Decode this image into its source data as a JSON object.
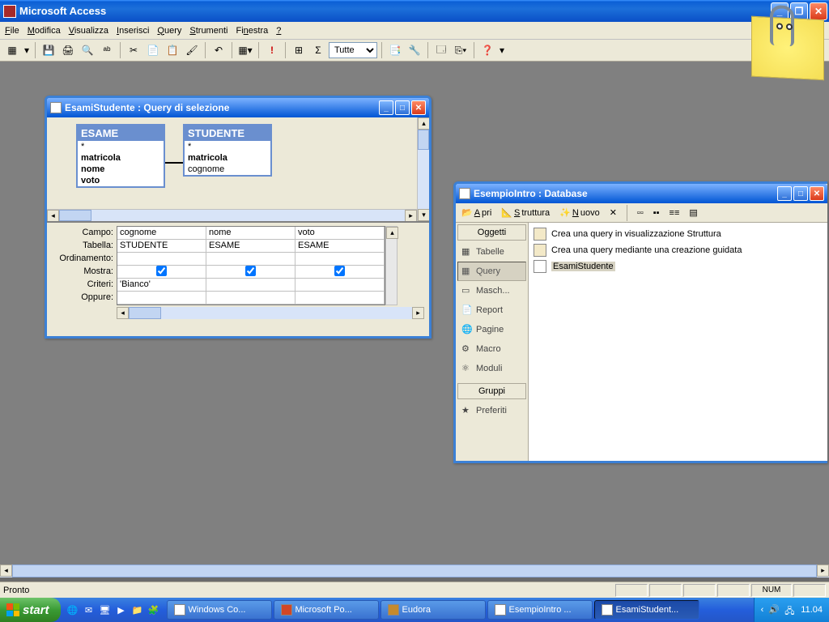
{
  "app": {
    "title": "Microsoft Access"
  },
  "menu": {
    "file": "File",
    "edit": "Modifica",
    "view": "Visualizza",
    "insert": "Inserisci",
    "query": "Query",
    "tools": "Strumenti",
    "window": "Finestra",
    "help": "?"
  },
  "toolbar": {
    "combo_value": "Tutte"
  },
  "queryWin": {
    "title": "EsamiStudente : Query di selezione",
    "tables": {
      "esame": {
        "name": "ESAME",
        "fields": [
          "*",
          "matricola",
          "nome",
          "voto"
        ],
        "bold": [
          1,
          2,
          3
        ]
      },
      "studente": {
        "name": "STUDENTE",
        "fields": [
          "*",
          "matricola",
          "cognome"
        ],
        "bold": [
          1
        ]
      }
    },
    "gridLabels": {
      "campo": "Campo:",
      "tabella": "Tabella:",
      "ordinamento": "Ordinamento:",
      "mostra": "Mostra:",
      "criteri": "Criteri:",
      "oppure": "Oppure:"
    },
    "columns": [
      {
        "campo": "cognome",
        "tabella": "STUDENTE",
        "mostra": true,
        "criteri": "'Bianco'"
      },
      {
        "campo": "nome",
        "tabella": "ESAME",
        "mostra": true,
        "criteri": ""
      },
      {
        "campo": "voto",
        "tabella": "ESAME",
        "mostra": true,
        "criteri": ""
      }
    ]
  },
  "dbWin": {
    "title": "EsempioIntro : Database",
    "toolbar": {
      "open": "Apri",
      "design": "Struttura",
      "new": "Nuovo"
    },
    "sideHeader1": "Oggetti",
    "sideHeader2": "Gruppi",
    "side": {
      "tabelle": "Tabelle",
      "query": "Query",
      "maschere": "Masch...",
      "report": "Report",
      "pagine": "Pagine",
      "macro": "Macro",
      "moduli": "Moduli",
      "preferiti": "Preferiti"
    },
    "items": {
      "createDesign": "Crea una query in visualizzazione Struttura",
      "createWizard": "Crea una query mediante una creazione guidata",
      "qname": "EsamiStudente"
    }
  },
  "status": {
    "ready": "Pronto",
    "num": "NUM"
  },
  "taskbar": {
    "start": "start",
    "buttons": {
      "b1": "Windows Co...",
      "b2": "Microsoft Po...",
      "b3": "Eudora",
      "b4": "EsempioIntro ...",
      "b5": "EsamiStudent..."
    },
    "clock": "11.04"
  }
}
